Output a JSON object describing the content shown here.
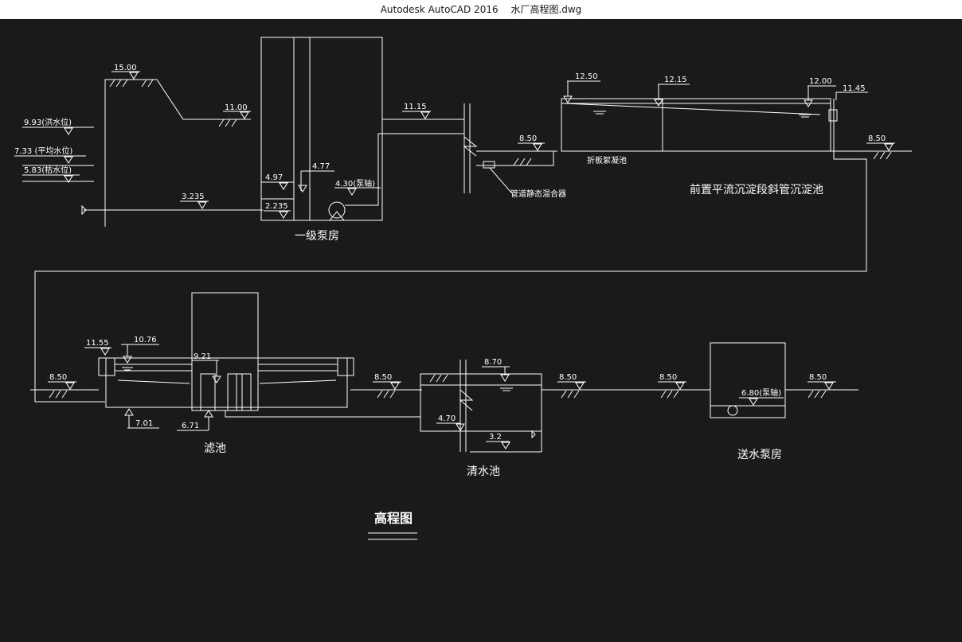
{
  "window": {
    "app_name": "Autodesk AutoCAD 2016",
    "file_name": "水厂高程图.dwg"
  },
  "drawing": {
    "title": "高程图",
    "structures": {
      "pump1": "一级泵房",
      "sedimentation": "前置平流沉淀段斜管沉淀池",
      "flocculation": "折板絮凝池",
      "mixer": "管道静态混合器",
      "filter": "滤池",
      "clearwell": "清水池",
      "pump2": "送水泵房"
    },
    "elevations": {
      "bank_top": "15.00",
      "bank_mid": "11.00",
      "flood_level": "9.93(洪水位)",
      "avg_level": "7.33 (平均水位)",
      "dry_level": "5.83(枯水位)",
      "intake_pipe": "3.235",
      "pump1_a": "4.97",
      "pump1_b": "4.77",
      "pump1_shaft": "4.30(泵轴)",
      "pump1_bottom": "2.235",
      "rising_main": "11.15",
      "ground_mix": "8.50",
      "floc_top": "12.50",
      "sed_mid": "12.15",
      "sed_end": "12.00",
      "sed_out": "11.45",
      "ground_sed": "8.50",
      "ground_filter_in": "8.50",
      "filter_top": "11.55",
      "filter_water": "10.76",
      "filter_mid": "9.21",
      "filter_bot1": "7.01",
      "filter_bot2": "6.71",
      "ground_cw1": "8.50",
      "cw_water": "8.70",
      "ground_cw2": "8.50",
      "cw_low": "4.70",
      "cw_bottom": "3.2",
      "ground_p2a": "8.50",
      "pump2_shaft": "6.80(泵轴)",
      "ground_p2b": "8.50"
    }
  }
}
